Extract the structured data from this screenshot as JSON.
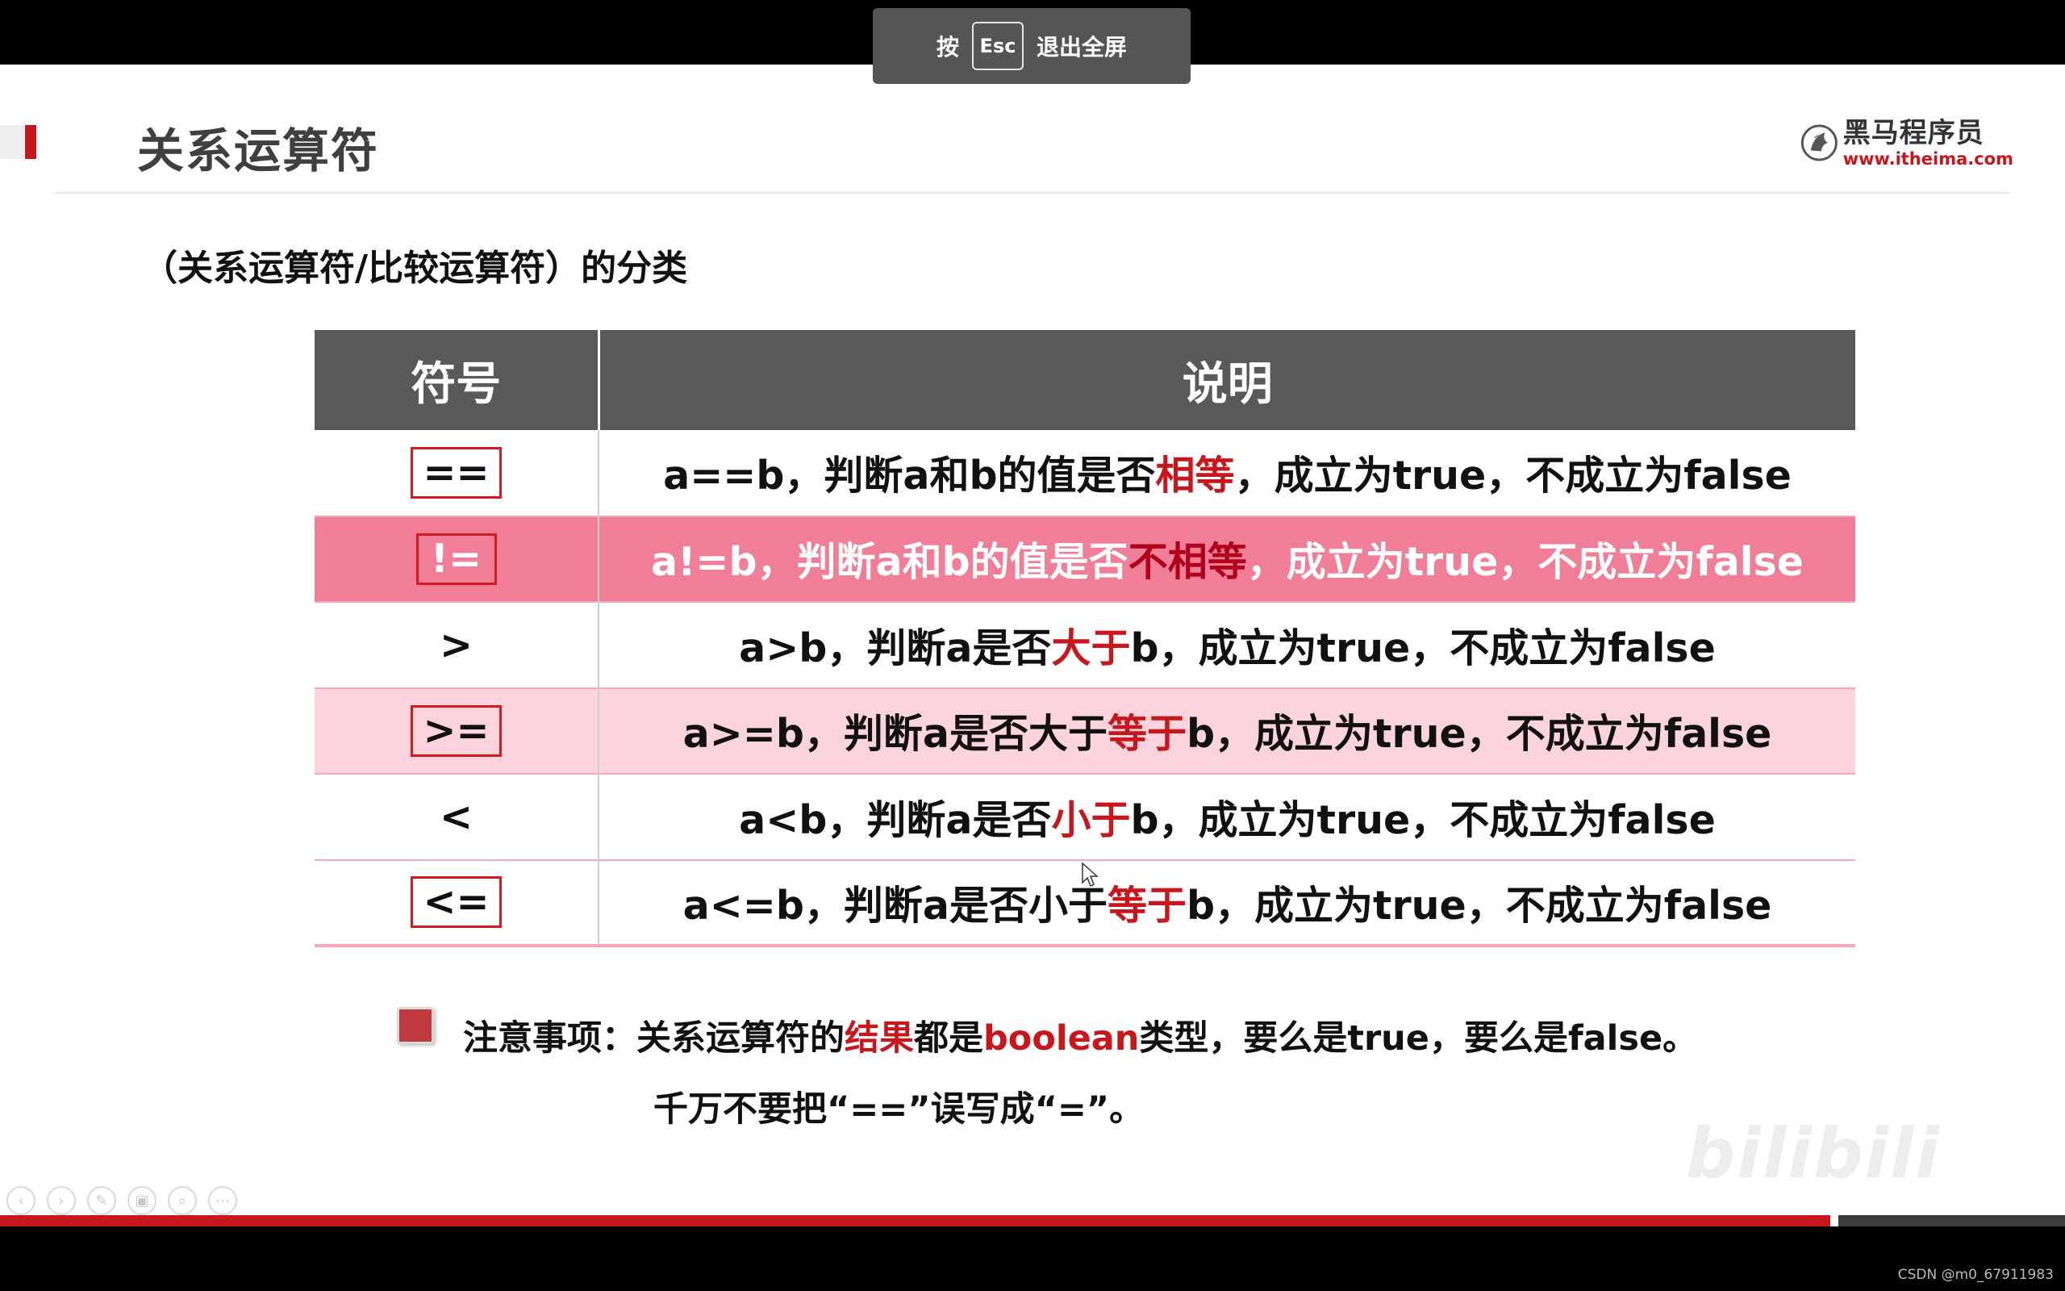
{
  "fullscreen_hint": {
    "press": "按",
    "key": "Esc",
    "action": "退出全屏"
  },
  "slide": {
    "title": "关系运算符",
    "subtitle": "（关系运算符/比较运算符）的分类"
  },
  "logo": {
    "name": "黑马程序员",
    "url": "www.itheima.com"
  },
  "table": {
    "headers": [
      "符号",
      "说明"
    ],
    "rows": [
      {
        "symbol": "==",
        "boxed": true,
        "desc_before": "a==b，判断a和b的值是否",
        "desc_highlight": "相等",
        "desc_after": "，成立为true，不成立为false"
      },
      {
        "symbol": "!=",
        "boxed": true,
        "desc_before": "a!=b，判断a和b的值是否",
        "desc_highlight": "不相等",
        "desc_after": "，成立为true，不成立为false"
      },
      {
        "symbol": ">",
        "boxed": false,
        "desc_before": "a>b，判断a是否",
        "desc_highlight": "大于",
        "desc_after": "b，成立为true，不成立为false"
      },
      {
        "symbol": ">=",
        "boxed": true,
        "desc_before": "a>=b，判断a是否大于",
        "desc_highlight": "等于",
        "desc_after": "b，成立为true，不成立为false"
      },
      {
        "symbol": "<",
        "boxed": false,
        "desc_before": "a<b，判断a是否",
        "desc_highlight": "小于",
        "desc_after": "b，成立为true，不成立为false"
      },
      {
        "symbol": "<=",
        "boxed": true,
        "desc_before": "a<=b，判断a是否小于",
        "desc_highlight": "等于",
        "desc_after": "b，成立为true，不成立为false"
      }
    ]
  },
  "note": {
    "line1_a": "注意事项：关系运算符的",
    "line1_hl1": "结果",
    "line1_b": "都是",
    "line1_hl2": "boolean",
    "line1_c": "类型，要么是true，要么是false。",
    "line2": "千万不要把“==”误写成“=”。"
  },
  "watermark": "bilibili",
  "credit": "CSDN @m0_67911983",
  "progress": {
    "fraction": 0.887
  },
  "colors": {
    "accent_red": "#c8161d",
    "header_gray": "#595959",
    "row_pink": "#fbd3dc",
    "row_pink_dark": "#f07e96"
  },
  "nav_icons": [
    "prev-icon",
    "next-icon",
    "pen-icon",
    "pages-icon",
    "zoom-icon",
    "more-icon"
  ]
}
